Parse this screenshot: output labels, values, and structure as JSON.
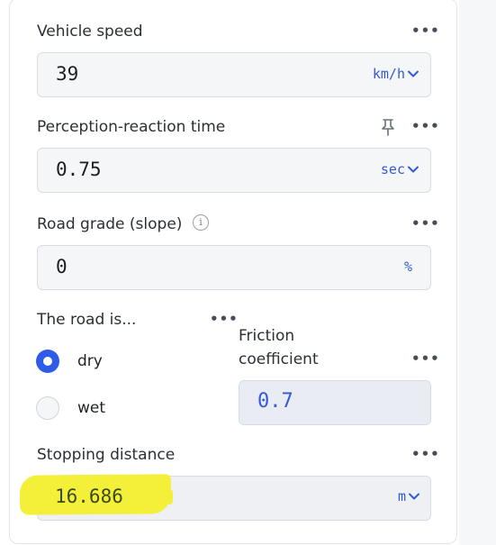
{
  "fields": {
    "vehicle_speed": {
      "label": "Vehicle speed",
      "value": "39",
      "unit": "km/h"
    },
    "perception_reaction_time": {
      "label": "Perception-reaction time",
      "value": "0.75",
      "unit": "sec"
    },
    "road_grade": {
      "label": "Road grade (slope)",
      "value": "0",
      "unit": "%"
    },
    "road_condition": {
      "label": "The road is...",
      "options": [
        {
          "label": "dry",
          "selected": true
        },
        {
          "label": "wet",
          "selected": false
        }
      ]
    },
    "friction_coefficient": {
      "label_line1": "Friction",
      "label_line2": "coefficient",
      "value": "0.7"
    },
    "stopping_distance": {
      "label": "Stopping distance",
      "value": "16.686",
      "unit": "m"
    }
  },
  "icons": {
    "menu": "more-horizontal-icon",
    "dropdown": "chevron-down-icon",
    "pin": "pin-icon",
    "info": "info-icon"
  },
  "colors": {
    "accent": "#3559d6",
    "radio_selected": "#2f5ce6",
    "highlight": "#f4f03a"
  }
}
